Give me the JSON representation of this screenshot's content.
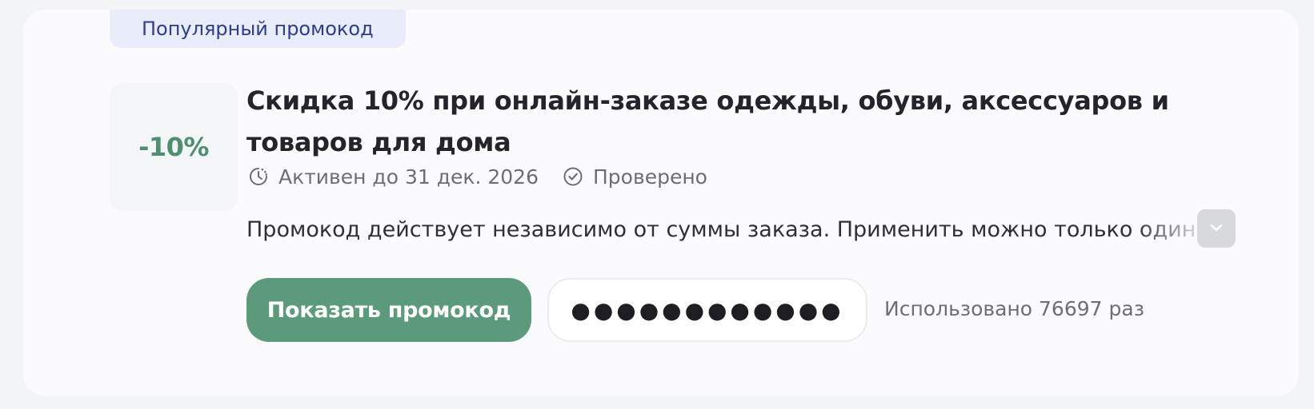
{
  "promo": {
    "badge": "Популярный промокод",
    "discount": "-10%",
    "title": "Скидка 10% при онлайн-заказе одежды, обуви, аксессуаров и товаров для дома",
    "meta": {
      "active_until": "Активен до 31 дек. 2026",
      "verified": "Проверено"
    },
    "description": "Промокод действует независимо от суммы заказа. Применить можно только один раз",
    "show_button_label": "Показать промокод",
    "masked_code": "●●●●●●●●●●●●",
    "usage_text": "Использовано 76697 раз"
  },
  "icons": {
    "active": "clock-icon",
    "verified": "check-circle-icon",
    "expand": "chevron-down-icon"
  },
  "colors": {
    "accent_green": "#5b9a7b",
    "discount_green": "#4f8f6f",
    "badge_background": "#e9ecfa",
    "badge_text": "#2d3e8f"
  }
}
